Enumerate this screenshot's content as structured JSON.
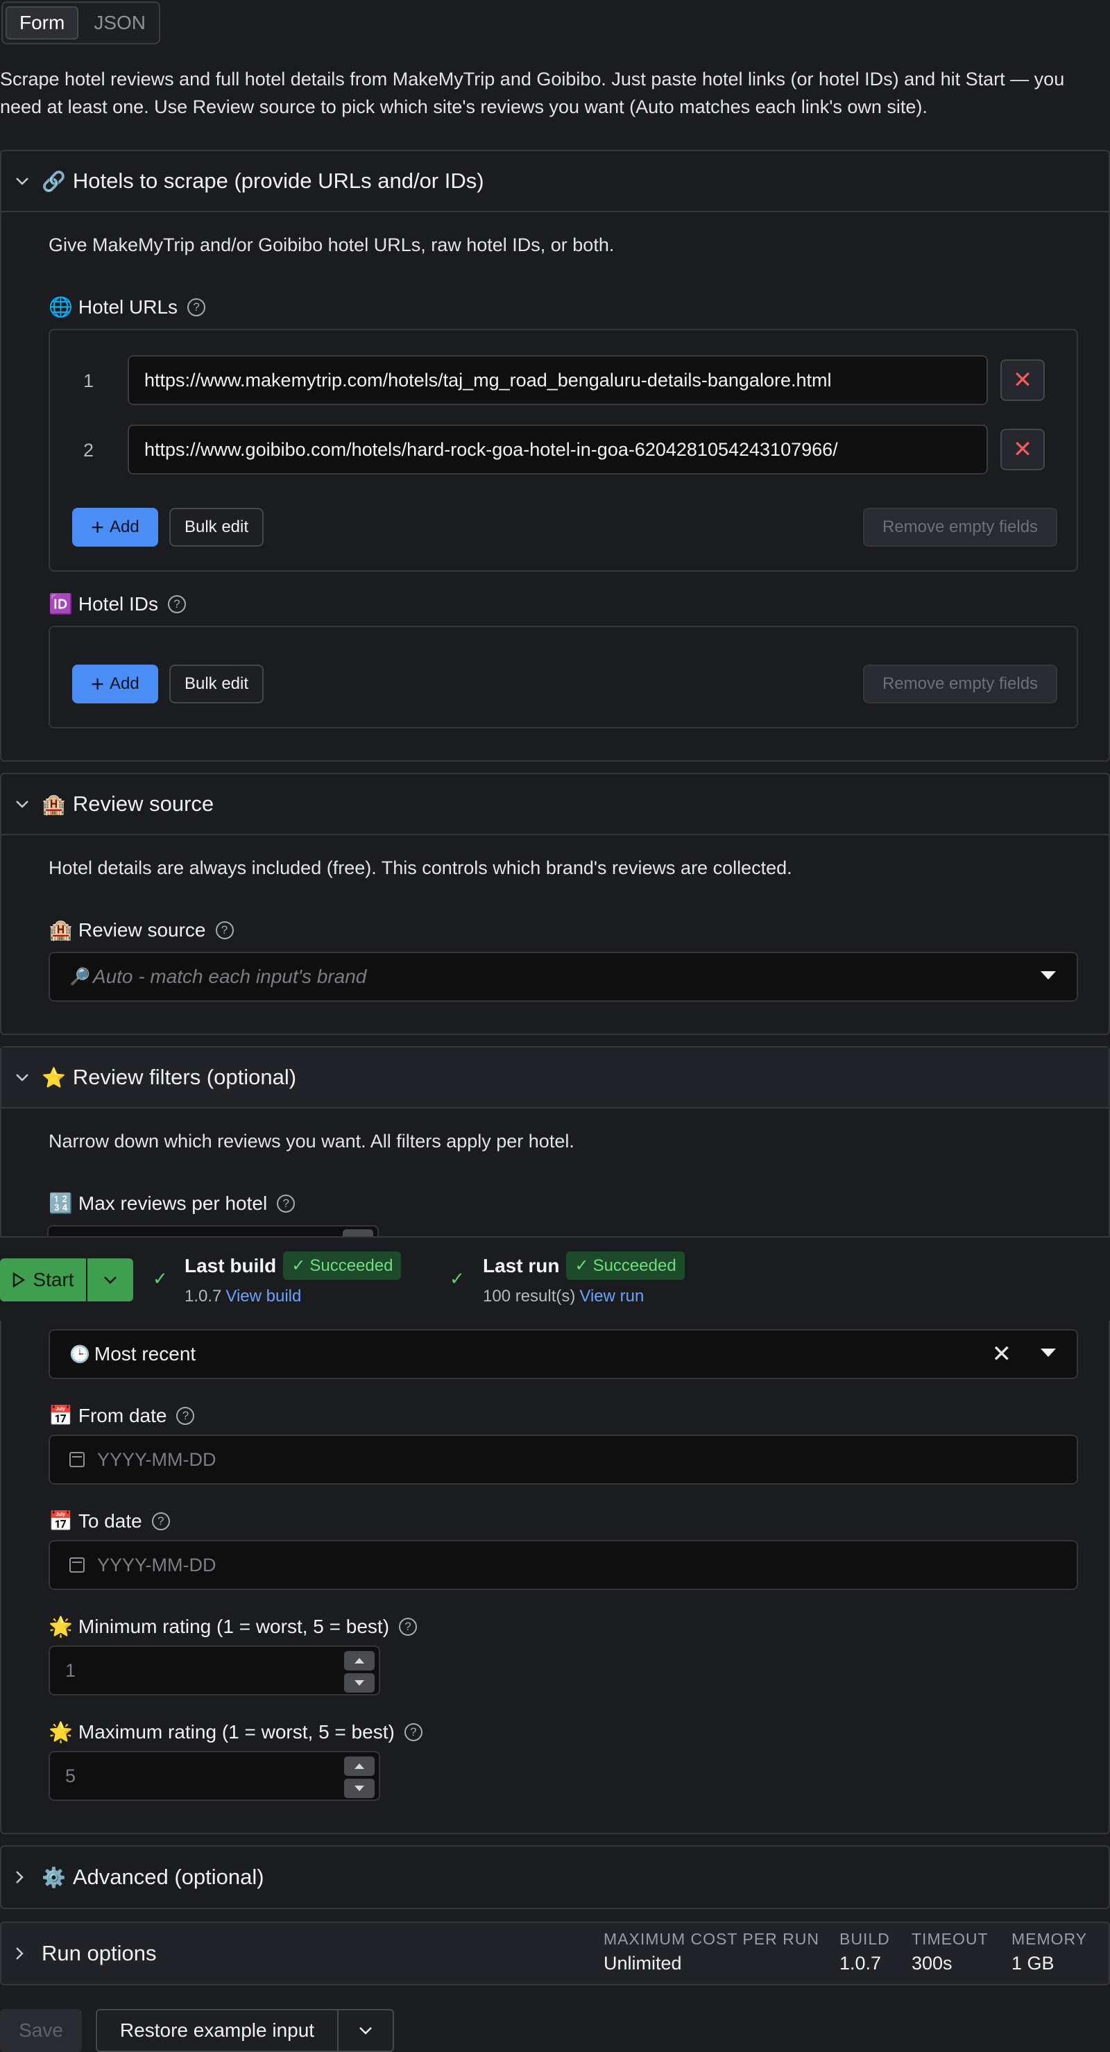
{
  "tabs": [
    {
      "label": "Form"
    },
    {
      "label": "JSON"
    }
  ],
  "intro": "Scrape hotel reviews and full hotel details from MakeMyTrip and Goibibo. Just paste hotel links (or hotel IDs) and hit Start — you need at least one. Use Review source to pick which site's reviews you want (Auto matches each link's own site).",
  "sections": {
    "hotels": {
      "emoji": "🔗",
      "title": "Hotels to scrape (provide URLs and/or IDs)",
      "description": "Give MakeMyTrip and/or Goibibo hotel URLs, raw hotel IDs, or both.",
      "urls_label": "Hotel URLs",
      "urls_emoji": "🌐",
      "urls": [
        {
          "index": "1",
          "value": "https://www.makemytrip.com/hotels/taj_mg_road_bengaluru-details-bangalore.html"
        },
        {
          "index": "2",
          "value": "https://www.goibibo.com/hotels/hard-rock-goa-hotel-in-goa-6204281054243107966/"
        }
      ],
      "ids_label": "Hotel IDs",
      "ids_emoji": "🆔",
      "add_label": "Add",
      "bulk_edit_label": "Bulk edit",
      "remove_empty_label": "Remove empty fields"
    },
    "review_source": {
      "emoji": "🏨",
      "title": "Review source",
      "description": "Hotel details are always included (free). This controls which brand's reviews are collected.",
      "field_label": "Review source",
      "field_emoji": "🏨",
      "placeholder_emoji": "🔎",
      "placeholder": "Auto - match each input's brand"
    },
    "review_filters": {
      "emoji": "⭐",
      "title": "Review filters (optional)",
      "description": "Narrow down which reviews you want. All filters apply per hotel.",
      "max_reviews_label": "Max reviews per hotel",
      "max_reviews_emoji": "🔢",
      "sort_emoji": "🕒",
      "sort_value": "Most recent",
      "from_date_label": "From date",
      "to_date_label": "To date",
      "date_emoji": "📅",
      "date_placeholder": "YYYY-MM-DD",
      "min_rating_label": "Minimum rating (1 = worst, 5 = best)",
      "min_rating_placeholder": "1",
      "max_rating_label": "Maximum rating (1 = worst, 5 = best)",
      "max_rating_placeholder": "5",
      "rating_emoji": "🌟"
    },
    "advanced": {
      "emoji": "⚙️",
      "title": "Advanced (optional)"
    },
    "run_options": {
      "title": "Run options",
      "meta": [
        {
          "label": "MAXIMUM COST PER RUN",
          "value": "Unlimited"
        },
        {
          "label": "BUILD",
          "value": "1.0.7"
        },
        {
          "label": "TIMEOUT",
          "value": "300s"
        },
        {
          "label": "MEMORY",
          "value": "1 GB"
        }
      ]
    }
  },
  "runbar": {
    "start_label": "Start",
    "last_build": {
      "title": "Last build",
      "status": "Succeeded",
      "detail": "1.0.7",
      "link": "View build"
    },
    "last_run": {
      "title": "Last run",
      "status": "Succeeded",
      "detail": "100 result(s)",
      "link": "View run"
    }
  },
  "footer": {
    "save_label": "Save",
    "restore_label": "Restore example input"
  },
  "colors": {
    "primary": "#4c8cf5",
    "success": "#3f9e4f",
    "danger": "#ef5a5a",
    "background": "#1b1c1f"
  }
}
